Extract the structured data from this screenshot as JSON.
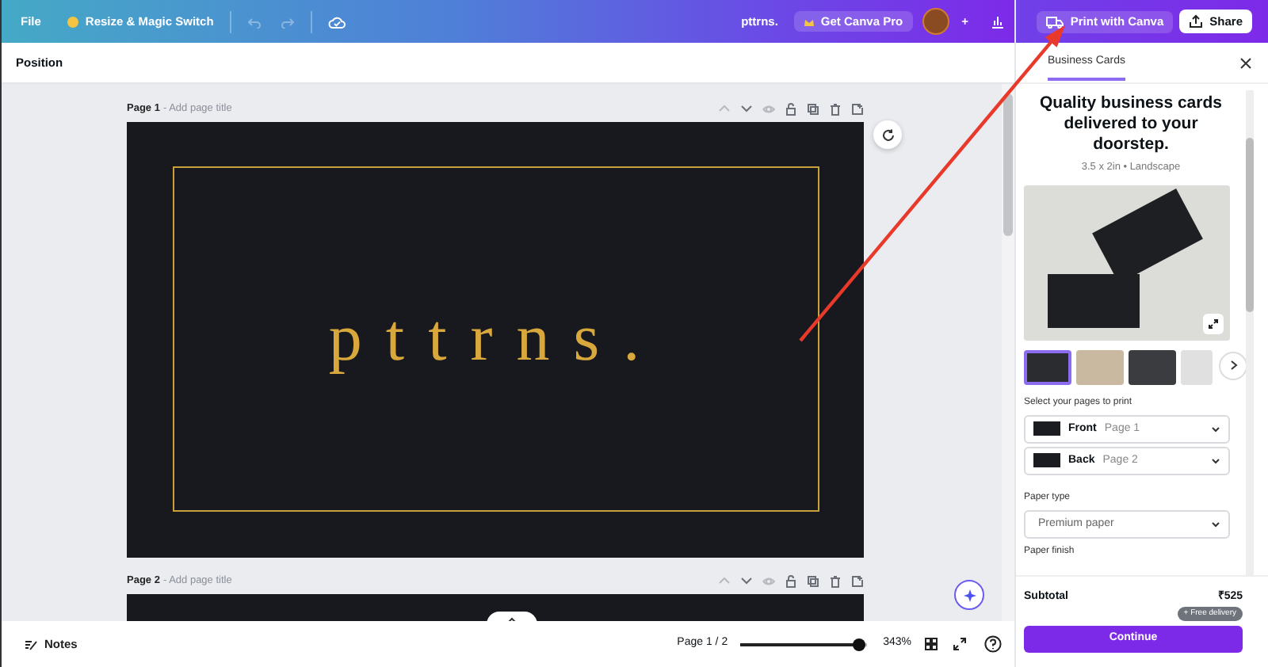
{
  "top_bar": {
    "menu": "File",
    "resize_button": "Resize & Magic Switch",
    "history_buttons": [
      {
        "kind": "undo",
        "disabled": true
      },
      {
        "kind": "redo",
        "disabled": true
      }
    ],
    "doc_title": "pttrns.",
    "pro_button": "Get Canva Pro",
    "add_button": "+",
    "print_button": "Print with Canva",
    "share_button": "Share"
  },
  "toolbar": {
    "label": "Position"
  },
  "pages": [
    {
      "label": "Page 1",
      "title_hint": "- Add page title",
      "design_text": "pttrns."
    },
    {
      "label": "Page 2",
      "title_hint": "- Add page title"
    }
  ],
  "right_panel": {
    "tab": "Business Cards",
    "heading": "Quality business cards delivered to your doorstep.",
    "size": "3.5 x 2in • Landscape",
    "thumbnails": [
      {
        "selected": true
      },
      {
        "selected": false
      },
      {
        "selected": false
      },
      {
        "selected": false
      }
    ],
    "pages_label": "Select your pages to print",
    "page_selects": [
      {
        "side": "Front",
        "page": "Page 1"
      },
      {
        "side": "Back",
        "page": "Page 2"
      }
    ],
    "paper_type_label": "Paper type",
    "paper_type": "Premium paper",
    "paper_finish_label": "Paper finish",
    "subtotal_label": "Subtotal",
    "subtotal": "₹525",
    "delivery_badge": "+ Free delivery",
    "continue_button": "Continue"
  },
  "bottom_bar": {
    "notes": "Notes",
    "page_indicator": "Page 1 / 2",
    "zoom": {
      "level": 0.94
    },
    "zoom_reading": "343%"
  }
}
